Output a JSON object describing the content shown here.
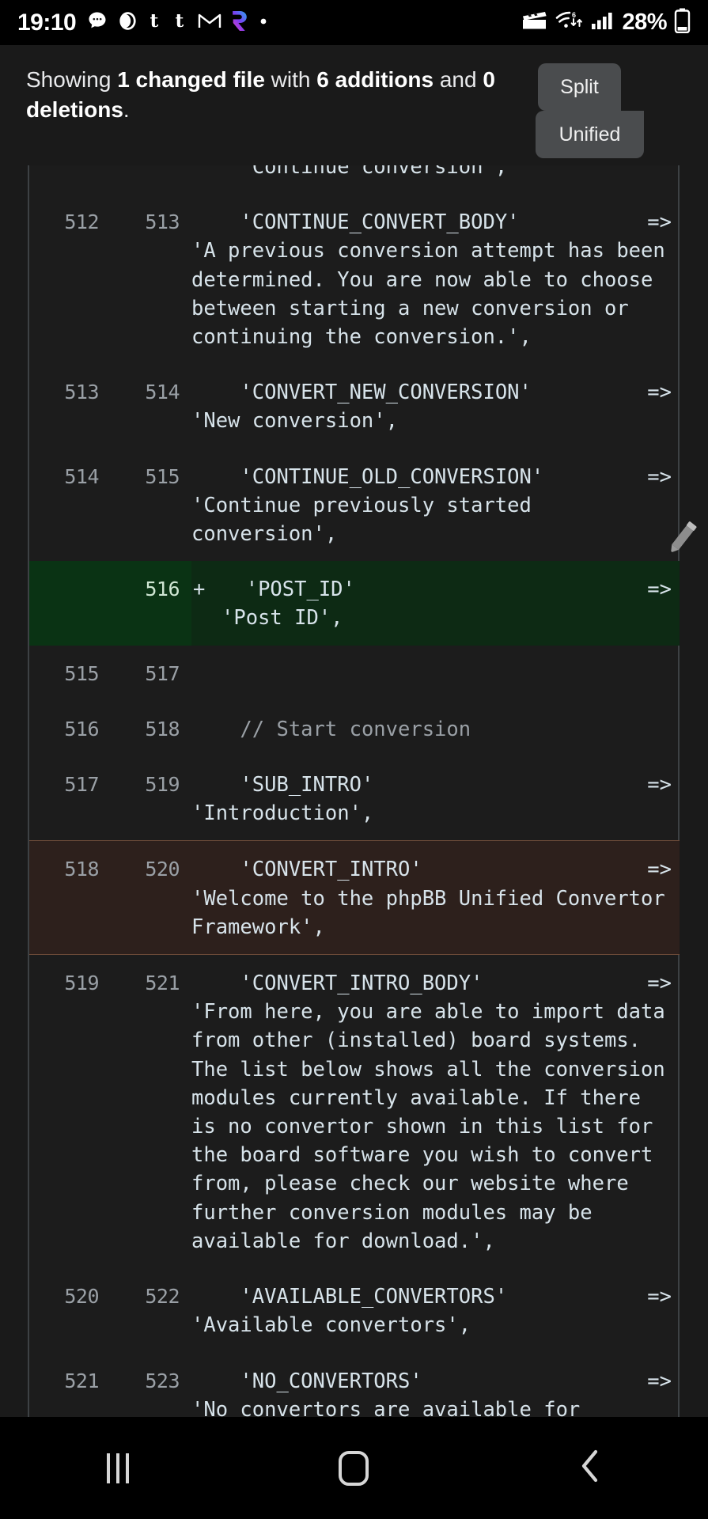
{
  "statusbar": {
    "clock": "19:10",
    "battery_percent": "28%",
    "notification_icons": [
      "chat-bubble-icon",
      "circle-icon",
      "tumblr-t-icon",
      "tumblr-t-icon-2",
      "gmail-m-icon",
      "revolut-r-icon",
      "more-dot-icon"
    ],
    "right_icons": [
      "screen-record-icon",
      "wifi-6-icon",
      "cellular-signal-icon",
      "battery-icon"
    ]
  },
  "header": {
    "summary_prefix": "Showing ",
    "summary_files": "1 changed file",
    "summary_mid": " with ",
    "summary_additions": "6 additions",
    "summary_and": " and ",
    "summary_deletions": "0 deletions",
    "summary_end": ".",
    "split_label": "Split",
    "unified_label": "Unified"
  },
  "diff": {
    "rows": [
      {
        "old": "",
        "new": "",
        "marker": "",
        "code": "    'Continue conversion',",
        "type": "context"
      },
      {
        "old": "512",
        "new": "513",
        "marker": "",
        "key": "    'CONTINUE_CONVERT_BODY'",
        "arrow": "=>",
        "value": "'A previous conversion attempt has been determined. You are now able to choose between starting a new conversion or continuing the conversion.',",
        "type": "context"
      },
      {
        "old": "513",
        "new": "514",
        "marker": "",
        "key": "    'CONVERT_NEW_CONVERSION'",
        "arrow": "=>",
        "value": "'New conversion',",
        "type": "context"
      },
      {
        "old": "514",
        "new": "515",
        "marker": "",
        "key": "    'CONTINUE_OLD_CONVERSION'",
        "arrow": "=>",
        "value": "'Continue previously started conversion',",
        "type": "context"
      },
      {
        "old": "",
        "new": "516",
        "marker": "+",
        "key": "  'POST_ID'",
        "arrow": "=>",
        "value": "'Post ID',",
        "type": "add"
      },
      {
        "old": "515",
        "new": "517",
        "marker": "",
        "code": "",
        "type": "context"
      },
      {
        "old": "516",
        "new": "518",
        "marker": "",
        "code": "    // Start conversion",
        "type": "comment"
      },
      {
        "old": "517",
        "new": "519",
        "marker": "",
        "key": "    'SUB_INTRO'",
        "arrow": "=>",
        "value": "'Introduction',",
        "type": "context"
      },
      {
        "old": "518",
        "new": "520",
        "marker": "",
        "key": "    'CONVERT_INTRO'",
        "arrow": "=>",
        "value": "'Welcome to the phpBB Unified Convertor Framework',",
        "type": "highlight"
      },
      {
        "old": "519",
        "new": "521",
        "marker": "",
        "key": "    'CONVERT_INTRO_BODY'",
        "arrow": "=>",
        "value": "'From here, you are able to import data from other (installed) board systems. The list below shows all the conversion modules currently available. If there is no convertor shown in this list for the board software you wish to convert from, please check our website where further conversion modules may be available for download.',",
        "type": "context"
      },
      {
        "old": "520",
        "new": "522",
        "marker": "",
        "key": "    'AVAILABLE_CONVERTORS'",
        "arrow": "=>",
        "value": "'Available convertors',",
        "type": "context"
      },
      {
        "old": "521",
        "new": "523",
        "marker": "",
        "key": "    'NO_CONVERTORS'",
        "arrow": "=>",
        "value": "'No convertors are available for",
        "type": "context"
      }
    ],
    "edit_cursor_icon": "pencil-icon"
  },
  "navbar": {
    "recents_label": "recents-icon",
    "home_label": "home-icon",
    "back_label": "back-icon"
  },
  "colors": {
    "add_bg": "#0d2a14",
    "add_gutter": "#0a3314",
    "highlight_bg": "#2d201c",
    "highlight_border": "#6b4a38",
    "code_text": "#d7e3ea",
    "line_number": "#9aa0a6"
  }
}
